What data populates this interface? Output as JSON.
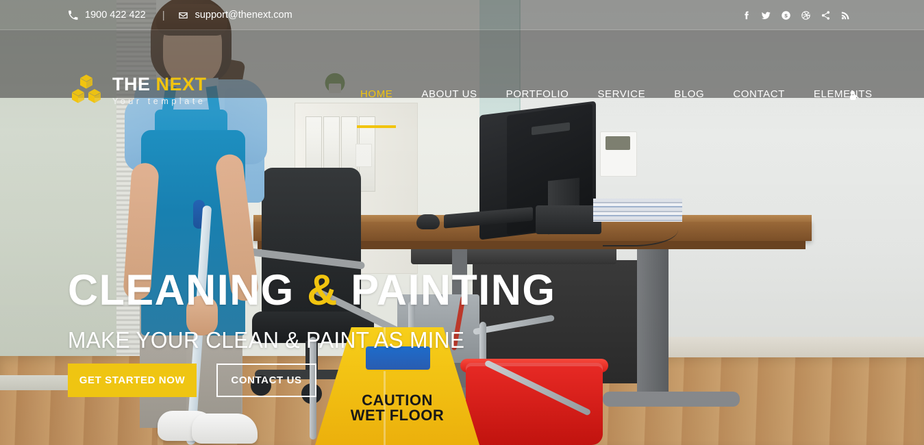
{
  "topbar": {
    "phone_icon": "phone-icon",
    "phone": "1900 422 422",
    "separator": "|",
    "email_icon": "envelope-icon",
    "email": "support@thenext.com",
    "socials": [
      {
        "name": "facebook-icon",
        "label": "Facebook"
      },
      {
        "name": "twitter-icon",
        "label": "Twitter"
      },
      {
        "name": "skype-icon",
        "label": "Skype"
      },
      {
        "name": "dribbble-icon",
        "label": "Dribbble"
      },
      {
        "name": "share-icon",
        "label": "Share"
      },
      {
        "name": "rss-icon",
        "label": "RSS"
      }
    ]
  },
  "brand": {
    "logo_icon": "cubes-logo-icon",
    "title_main": "THE ",
    "title_accent": "NEXT",
    "tagline": "Your template"
  },
  "nav": {
    "items": [
      {
        "label": "HOME",
        "active": true
      },
      {
        "label": "ABOUT US",
        "active": false
      },
      {
        "label": "PORTFOLIO",
        "active": false
      },
      {
        "label": "SERVICE",
        "active": false
      },
      {
        "label": "BLOG",
        "active": false
      },
      {
        "label": "CONTACT",
        "active": false
      },
      {
        "label": "ELEMENTS",
        "active": false
      }
    ],
    "search_icon": "search-icon"
  },
  "hero": {
    "title_part1": "CLEANING ",
    "title_amp": "&",
    "title_part2": " PAINTING",
    "subtitle": "MAKE YOUR CLEAN & PAINT AS MINE",
    "primary_button": "GET STARTED NOW",
    "outline_button": "CONTACT US"
  },
  "scene": {
    "caution_line1": "CAUTION",
    "caution_line2": "WET FLOOR"
  },
  "colors": {
    "accent": "#f1c40f",
    "button": "#efc512",
    "header_overlay": "#4a4a48",
    "text_light": "#ffffff"
  }
}
